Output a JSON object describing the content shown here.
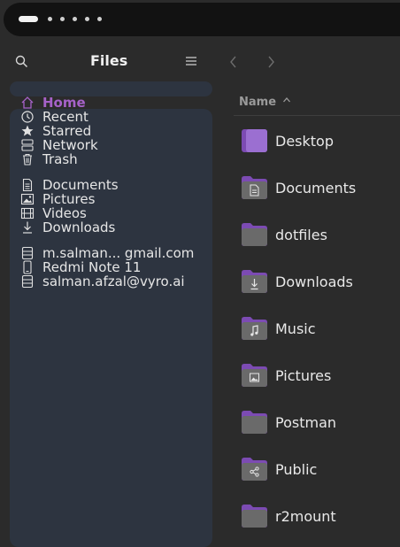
{
  "panel": {
    "workspace_count": 6,
    "active_workspace": 1
  },
  "sidebar": {
    "title": "Files",
    "places": [
      {
        "label": "Home",
        "icon": "home-icon",
        "active": true
      },
      {
        "label": "Recent",
        "icon": "clock-icon"
      },
      {
        "label": "Starred",
        "icon": "star-icon"
      },
      {
        "label": "Network",
        "icon": "network-icon"
      },
      {
        "label": "Trash",
        "icon": "trash-icon"
      }
    ],
    "bookmarks": [
      {
        "label": "Documents",
        "icon": "document-icon"
      },
      {
        "label": "Pictures",
        "icon": "image-icon"
      },
      {
        "label": "Videos",
        "icon": "film-icon"
      },
      {
        "label": "Downloads",
        "icon": "download-icon"
      }
    ],
    "devices": [
      {
        "label": "m.salman... gmail.com",
        "icon": "drive-icon"
      },
      {
        "label": "Redmi Note 11",
        "icon": "phone-icon"
      },
      {
        "label": "salman.afzal@vyro.ai",
        "icon": "drive-icon"
      }
    ]
  },
  "content": {
    "column_name": "Name",
    "sort": "ascending",
    "items": [
      {
        "name": "Desktop",
        "icon": "desktop-folder-icon"
      },
      {
        "name": "Documents",
        "icon": "documents-folder-icon"
      },
      {
        "name": "dotfiles",
        "icon": "folder-icon"
      },
      {
        "name": "Downloads",
        "icon": "downloads-folder-icon"
      },
      {
        "name": "Music",
        "icon": "music-folder-icon"
      },
      {
        "name": "Pictures",
        "icon": "pictures-folder-icon"
      },
      {
        "name": "Postman",
        "icon": "folder-icon"
      },
      {
        "name": "Public",
        "icon": "public-folder-icon"
      },
      {
        "name": "r2mount",
        "icon": "folder-icon"
      }
    ]
  },
  "colors": {
    "accent": "#a662c9",
    "folder": "#7c4bb3",
    "sidebar": "#2d3440",
    "background": "#2b2b2b"
  }
}
